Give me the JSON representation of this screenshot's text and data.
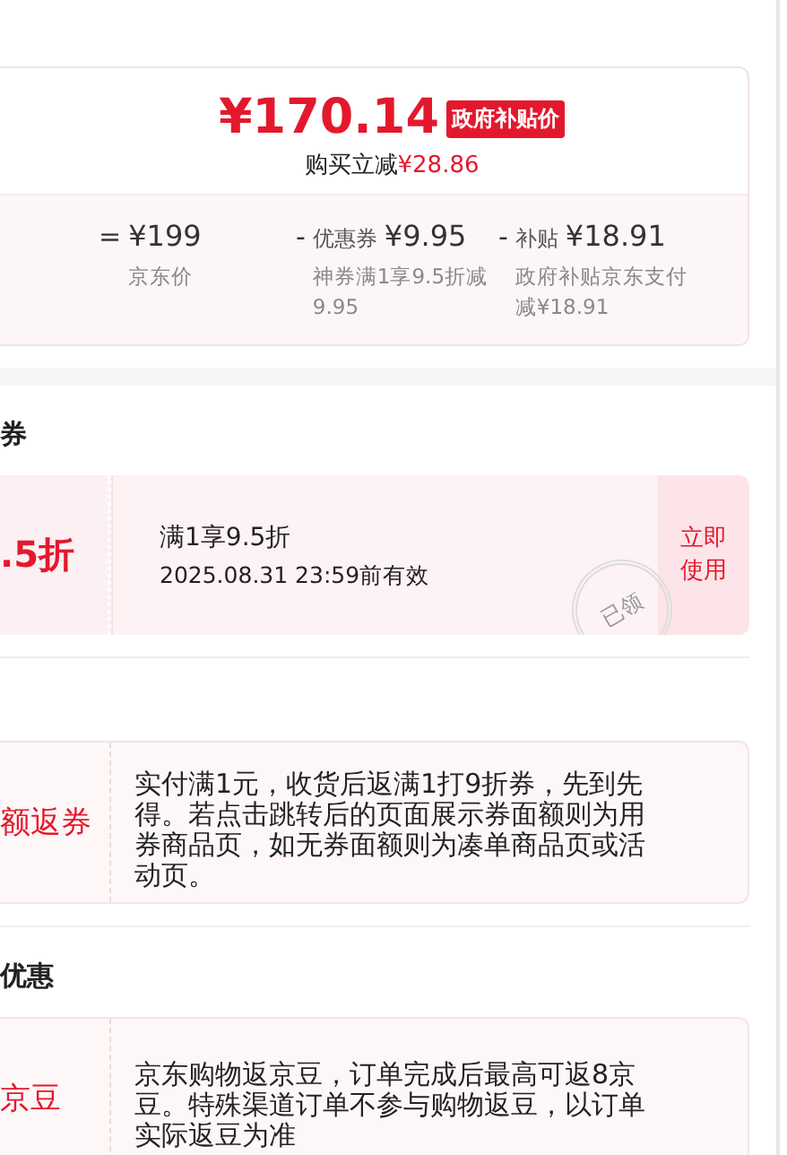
{
  "price_summary": {
    "final_price": "¥170.14",
    "badge": "政府补贴价",
    "saving_label": "购买立减",
    "saving_amount": "¥28.86",
    "breakdown": [
      {
        "operator": "=",
        "amount": "¥199",
        "note": "京东价"
      },
      {
        "operator": "-",
        "label": "优惠券",
        "amount": "¥9.95",
        "note": "神券满1享9.5折减9.95"
      },
      {
        "operator": "-",
        "label": "补贴",
        "amount": "¥18.91",
        "note": "政府补贴京东支付减¥18.91"
      }
    ]
  },
  "sections": [
    {
      "heading": "券",
      "kind": "coupon",
      "value": ".5折",
      "title": "满1享9.5折",
      "validity": "2025.08.31 23:59前有效",
      "stamp": "已领",
      "action": "立即使用"
    },
    {
      "kind": "rebate",
      "value": "额返券",
      "description": "实付满1元，收货后返满1打9折券，先到先得。若点击跳转后的页面展示券面额则为用券商品页，如无券面额则为凑单商品页或活动页。"
    },
    {
      "heading": "优惠",
      "kind": "rebate",
      "value": "京豆",
      "description": "京东购物返京豆，订单完成后最高可返8京豆。特殊渠道订单不参与购物返豆，以订单实际返豆为准"
    }
  ]
}
